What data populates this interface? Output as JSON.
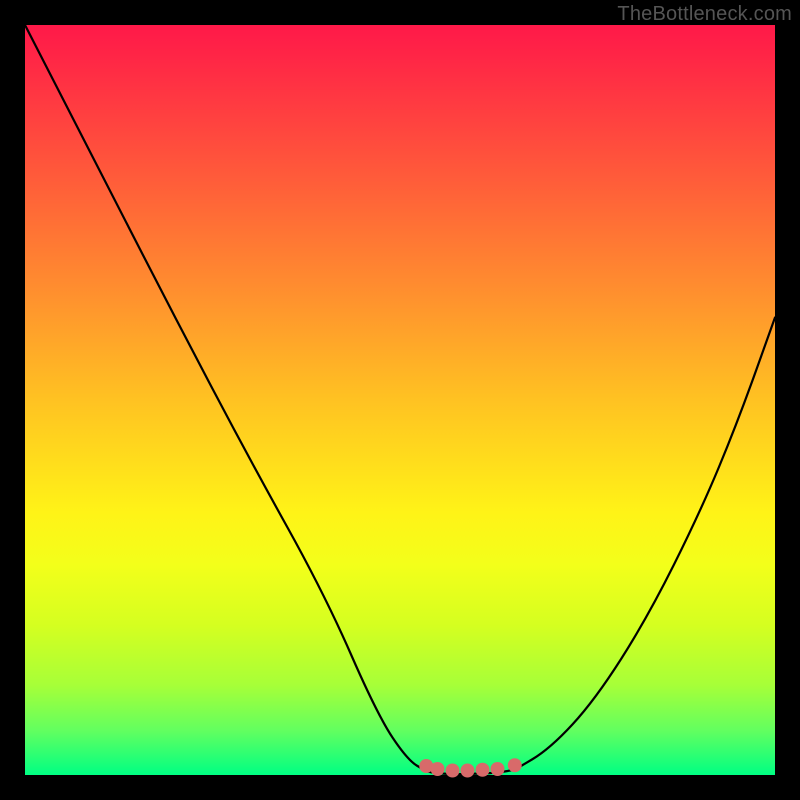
{
  "watermark": "TheBottleneck.com",
  "colors": {
    "frame": "#000000",
    "curve": "#000000",
    "marker_fill": "#d86a6a",
    "marker_stroke": "#d86a6a",
    "gradient_top": "#ff1949",
    "gradient_bottom": "#00ff83"
  },
  "chart_data": {
    "type": "line",
    "title": "",
    "xlabel": "",
    "ylabel": "",
    "xlim": [
      0,
      100
    ],
    "ylim": [
      0,
      100
    ],
    "grid": false,
    "legend": false,
    "series": [
      {
        "name": "left-curve",
        "x": [
          0,
          10,
          20,
          30,
          40,
          47,
          51,
          53.5
        ],
        "y": [
          100,
          80.5,
          61,
          42,
          24,
          8,
          2,
          0.5
        ]
      },
      {
        "name": "valley-floor",
        "x": [
          53.5,
          55,
          58,
          61,
          63,
          65.3
        ],
        "y": [
          0.5,
          0.2,
          0.1,
          0.2,
          0.3,
          0.7
        ]
      },
      {
        "name": "right-curve",
        "x": [
          65.3,
          70,
          76,
          83,
          90,
          95,
          100
        ],
        "y": [
          0.7,
          3.5,
          10,
          21,
          35,
          47,
          61
        ]
      }
    ],
    "markers": [
      {
        "name": "valley-marker-1",
        "x": 53.5,
        "y": 1.2
      },
      {
        "name": "valley-marker-2",
        "x": 55.0,
        "y": 0.8
      },
      {
        "name": "valley-marker-3",
        "x": 57.0,
        "y": 0.6
      },
      {
        "name": "valley-marker-4",
        "x": 59.0,
        "y": 0.6
      },
      {
        "name": "valley-marker-5",
        "x": 61.0,
        "y": 0.7
      },
      {
        "name": "valley-marker-6",
        "x": 63.0,
        "y": 0.8
      },
      {
        "name": "valley-marker-7",
        "x": 65.3,
        "y": 1.3
      }
    ]
  }
}
